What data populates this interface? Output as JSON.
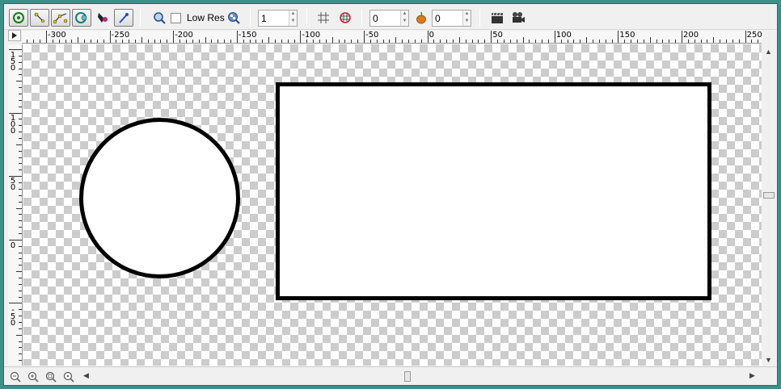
{
  "toolbar": {
    "tools": [
      {
        "name": "transform-tool",
        "icon": "transform-icon",
        "active": true
      },
      {
        "name": "smooth-move-tool",
        "icon": "smooth-move-icon",
        "active": true
      },
      {
        "name": "scale-tool",
        "icon": "scale-icon",
        "active": true
      },
      {
        "name": "rotate-tool",
        "icon": "rotate-icon",
        "active": true
      },
      {
        "name": "fill-tool",
        "icon": "fill-icon",
        "active": false
      },
      {
        "name": "draw-tool",
        "icon": "draw-icon",
        "active": true
      }
    ],
    "low_res_label": "Low Res",
    "low_res_checked": false,
    "zoom_value": "1",
    "onion_past_value": "0",
    "onion_future_value": "0"
  },
  "hruler": {
    "labels": [
      "-300",
      "-250",
      "-200",
      "-150",
      "-100",
      "-50",
      "0",
      "50",
      "100",
      "150",
      "200",
      "250"
    ]
  },
  "vruler": {
    "labels": [
      {
        "text": "1\n5\n0"
      },
      {
        "text": "1\n0\n0"
      },
      {
        "text": "5\n0"
      },
      {
        "text": "0"
      },
      {
        "text": "-\n5\n0"
      }
    ]
  },
  "colors": {
    "window_border": "#3d8f8a",
    "checker_dark": "#cccccc",
    "checker_light": "#ffffff",
    "shape_outline": "#000000",
    "shape_fill": "#ffffff"
  }
}
